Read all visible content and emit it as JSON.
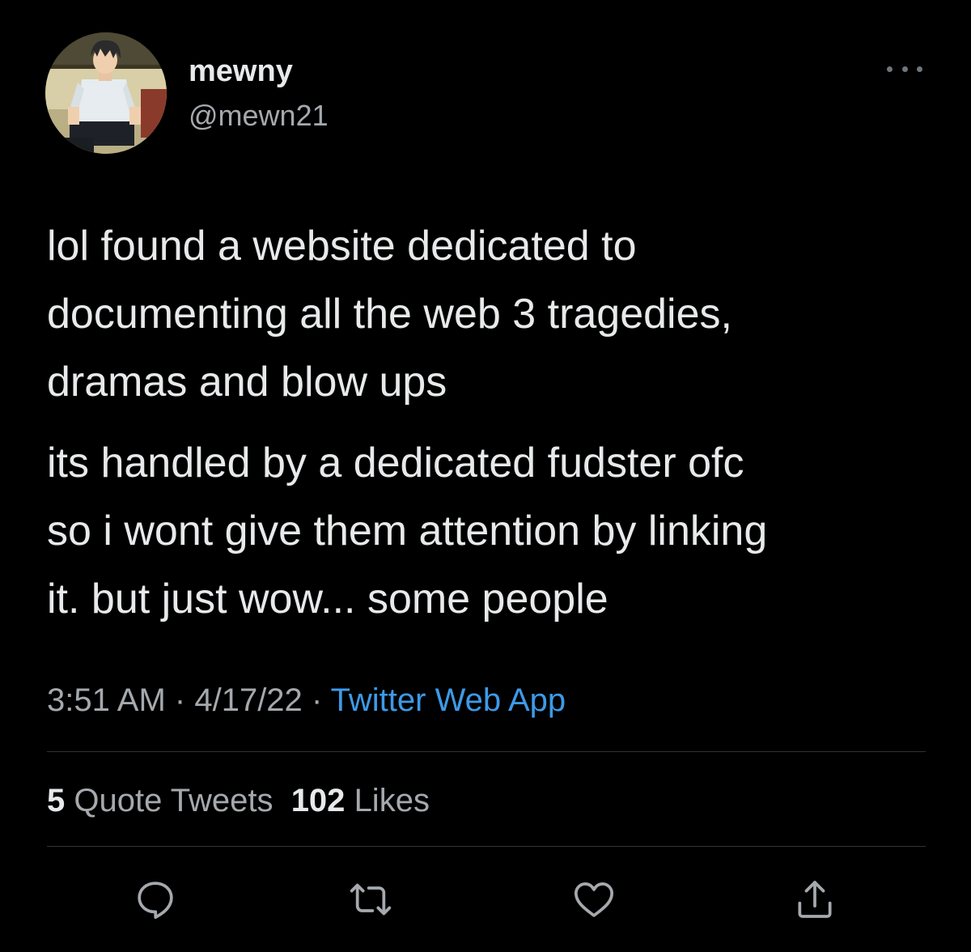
{
  "user": {
    "display_name": "mewny",
    "handle": "@mewn21",
    "avatar_icon": "anime-character-avatar"
  },
  "tweet": {
    "paragraphs": [
      "lol found a website dedicated to\ndocumenting all the web 3 tragedies,\ndramas and blow ups",
      "its handled by a dedicated fudster ofc\nso i wont give them attention by linking\nit. but just wow... some people"
    ],
    "time": "3:51 AM",
    "separator": "·",
    "date": "4/17/22",
    "source": "Twitter Web App"
  },
  "stats": {
    "quote_tweets_count": "5",
    "quote_tweets_label": "Quote Tweets",
    "likes_count": "102",
    "likes_label": "Likes"
  },
  "actions": {
    "reply_icon": "reply-icon",
    "retweet_icon": "retweet-icon",
    "like_icon": "heart-icon",
    "share_icon": "share-icon"
  },
  "colors": {
    "background": "#000000",
    "text_primary": "#e7e9ea",
    "text_secondary": "#a5a9ad",
    "link": "#3d9ae8",
    "divider": "#2f3336",
    "icon": "#a5a9ad"
  }
}
